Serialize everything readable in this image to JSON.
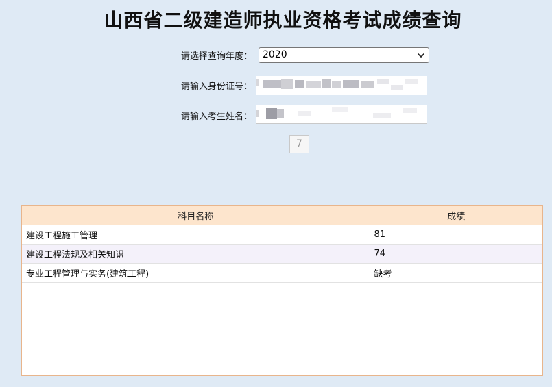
{
  "page": {
    "title": "山西省二级建造师执业资格考试成绩查询"
  },
  "form": {
    "year_label": "请选择查询年度：",
    "year_value": "2020",
    "id_label": "请输入身份证号：",
    "name_label": "请输入考生姓名：",
    "submit_label": "7"
  },
  "results": {
    "headers": [
      "科目名称",
      "成绩"
    ],
    "rows": [
      {
        "subject": "建设工程施工管理",
        "score": "81"
      },
      {
        "subject": "建设工程法规及相关知识",
        "score": "74"
      },
      {
        "subject": "专业工程管理与实务(建筑工程)",
        "score": "缺考"
      }
    ]
  },
  "colors": {
    "background": "#dfeaf5",
    "table_border": "#e8b58c",
    "table_header": "#fde5cd",
    "row_alt": "#f4f1fa"
  },
  "icons": {
    "select_arrow": "chevron-down-icon"
  }
}
